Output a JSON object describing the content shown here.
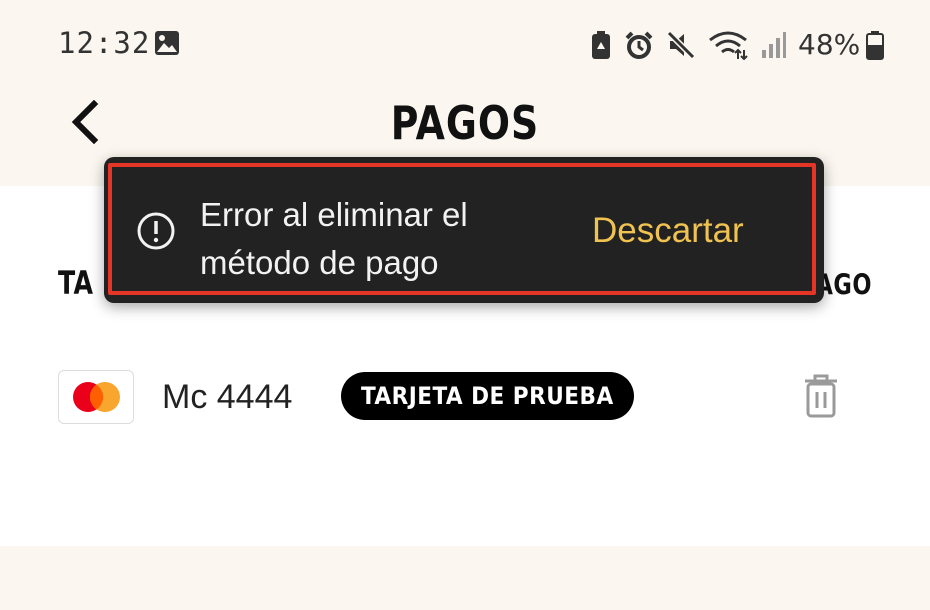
{
  "status_bar": {
    "time": "12:32",
    "battery_percent": "48%",
    "icons": [
      "gallery-icon",
      "battery-saver-icon",
      "alarm-icon",
      "mute-icon",
      "wifi-icon",
      "signal-icon",
      "battery-icon"
    ]
  },
  "header": {
    "title": "PAGOS",
    "back_icon": "chevron-left-icon"
  },
  "section": {
    "left_label_visible": "TA",
    "right_label_visible": "AGO"
  },
  "payment_method": {
    "brand_icon": "mastercard-icon",
    "label": "Mc 4444",
    "badge": "TARJETA DE PRUEBA",
    "delete_icon": "trash-icon"
  },
  "toast": {
    "icon": "alert-circle-icon",
    "message": "Error al eliminar el método de pago",
    "action_label": "Descartar"
  },
  "colors": {
    "background": "#fbf7f0",
    "content_background": "#ffffff",
    "toast_background": "#222222",
    "toast_action": "#f0c250",
    "highlight_border": "#e53527",
    "badge_background": "#000000",
    "mastercard_red": "#eb001b",
    "mastercard_orange": "#f79e1b"
  }
}
